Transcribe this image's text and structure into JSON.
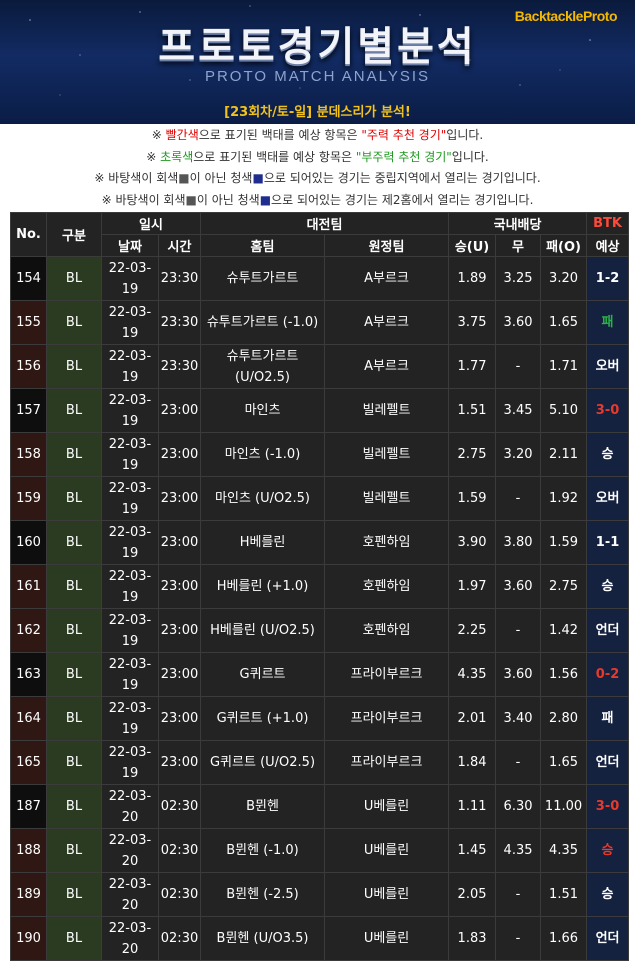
{
  "header": {
    "brand": "BacktackleProto",
    "title": "프로토경기별분석",
    "subtitle": "PROTO MATCH ANALYSIS",
    "round": "[23회차/토-일] 분데스리가 분석!"
  },
  "notes": {
    "n1_a": "※ ",
    "n1_b": "빨간색",
    "n1_c": "으로 표기된 백태를 예상 항목은 ",
    "n1_d": "\"주력 추천 경기\"",
    "n1_e": "입니다.",
    "n2_a": "※ ",
    "n2_b": "초록색",
    "n2_c": "으로 표기된 백태를 예상 항목은 ",
    "n2_d": "\"부주력 추천 경기\"",
    "n2_e": "입니다.",
    "n3_a": "※ 바탕색이 회색",
    "n3_b": "■",
    "n3_c": "이 아닌 청색",
    "n3_d": "■",
    "n3_e": "으로 되어있는 경기는 중립지역에서 열리는 경기입니다.",
    "n4_a": "※ 바탕색이 회색",
    "n4_b": "■",
    "n4_c": "이 아닌 청색",
    "n4_d": "■",
    "n4_e": "으로 되어있는 경기는 제2홈에서 열리는 경기입니다."
  },
  "table": {
    "h_no": "No.",
    "h_div": "구분",
    "h_datetime": "일시",
    "h_match": "대전팀",
    "h_odds": "국내배당",
    "h_btk_1": "BTK",
    "h_btk_2": "예상",
    "h_date": "날짜",
    "h_time": "시간",
    "h_home": "홈팀",
    "h_away": "원정팀",
    "h_win": "승(U)",
    "h_draw": "무",
    "h_lose": "패(O)"
  },
  "rows": [
    {
      "no": "154",
      "div": "BL",
      "date1": "22-03-",
      "date2": "19",
      "time": "23:30",
      "home": "슈투트가르트",
      "away": "A부르크",
      "w": "1.89",
      "d": "3.25",
      "l": "3.20",
      "pred": "1-2",
      "pc": "white",
      "nr": false
    },
    {
      "no": "155",
      "div": "BL",
      "date1": "22-03-",
      "date2": "19",
      "time": "23:30",
      "home": "슈투트가르트 (-1.0)",
      "away": "A부르크",
      "w": "3.75",
      "d": "3.60",
      "l": "1.65",
      "pred": "패",
      "pc": "green",
      "nr": true
    },
    {
      "no": "156",
      "div": "BL",
      "date1": "22-03-",
      "date2": "19",
      "time": "23:30",
      "home": "슈투트가르트",
      "home2": "(U/O2.5)",
      "away": "A부르크",
      "w": "1.77",
      "d": "-",
      "l": "1.71",
      "pred": "오버",
      "pc": "white",
      "nr": true
    },
    {
      "no": "157",
      "div": "BL",
      "date1": "22-03-",
      "date2": "19",
      "time": "23:00",
      "home": "마인츠",
      "away": "빌레펠트",
      "w": "1.51",
      "d": "3.45",
      "l": "5.10",
      "pred": "3-0",
      "pc": "red",
      "nr": false
    },
    {
      "no": "158",
      "div": "BL",
      "date1": "22-03-",
      "date2": "19",
      "time": "23:00",
      "home": "마인츠 (-1.0)",
      "away": "빌레펠트",
      "w": "2.75",
      "d": "3.20",
      "l": "2.11",
      "pred": "승",
      "pc": "white",
      "nr": true
    },
    {
      "no": "159",
      "div": "BL",
      "date1": "22-03-",
      "date2": "19",
      "time": "23:00",
      "home": "마인츠 (U/O2.5)",
      "away": "빌레펠트",
      "w": "1.59",
      "d": "-",
      "l": "1.92",
      "pred": "오버",
      "pc": "white",
      "nr": true
    },
    {
      "no": "160",
      "div": "BL",
      "date1": "22-03-",
      "date2": "19",
      "time": "23:00",
      "home": "H베를린",
      "away": "호펜하임",
      "w": "3.90",
      "d": "3.80",
      "l": "1.59",
      "pred": "1-1",
      "pc": "white",
      "nr": false
    },
    {
      "no": "161",
      "div": "BL",
      "date1": "22-03-",
      "date2": "19",
      "time": "23:00",
      "home": "H베를린 (+1.0)",
      "away": "호펜하임",
      "w": "1.97",
      "d": "3.60",
      "l": "2.75",
      "pred": "승",
      "pc": "white",
      "nr": true
    },
    {
      "no": "162",
      "div": "BL",
      "date1": "22-03-",
      "date2": "19",
      "time": "23:00",
      "home": "H베를린 (U/O2.5)",
      "away": "호펜하임",
      "w": "2.25",
      "d": "-",
      "l": "1.42",
      "pred": "언더",
      "pc": "white",
      "nr": true
    },
    {
      "no": "163",
      "div": "BL",
      "date1": "22-03-",
      "date2": "19",
      "time": "23:00",
      "home": "G퀴르트",
      "away": "프라이부르크",
      "w": "4.35",
      "d": "3.60",
      "l": "1.56",
      "pred": "0-2",
      "pc": "red",
      "nr": false
    },
    {
      "no": "164",
      "div": "BL",
      "date1": "22-03-",
      "date2": "19",
      "time": "23:00",
      "home": "G퀴르트 (+1.0)",
      "away": "프라이부르크",
      "w": "2.01",
      "d": "3.40",
      "l": "2.80",
      "pred": "패",
      "pc": "white",
      "nr": true
    },
    {
      "no": "165",
      "div": "BL",
      "date1": "22-03-",
      "date2": "19",
      "time": "23:00",
      "home": "G퀴르트 (U/O2.5)",
      "away": "프라이부르크",
      "w": "1.84",
      "d": "-",
      "l": "1.65",
      "pred": "언더",
      "pc": "white",
      "nr": true
    },
    {
      "no": "187",
      "div": "BL",
      "date1": "22-03-",
      "date2": "20",
      "time": "02:30",
      "home": "B뮌헨",
      "away": "U베를린",
      "w": "1.11",
      "d": "6.30",
      "l": "11.00",
      "pred": "3-0",
      "pc": "red",
      "nr": false
    },
    {
      "no": "188",
      "div": "BL",
      "date1": "22-03-",
      "date2": "20",
      "time": "02:30",
      "home": "B뮌헨 (-1.0)",
      "away": "U베를린",
      "w": "1.45",
      "d": "4.35",
      "l": "4.35",
      "pred": "승",
      "pc": "red",
      "nr": true
    },
    {
      "no": "189",
      "div": "BL",
      "date1": "22-03-",
      "date2": "20",
      "time": "02:30",
      "home": "B뮌헨 (-2.5)",
      "away": "U베를린",
      "w": "2.05",
      "d": "-",
      "l": "1.51",
      "pred": "승",
      "pc": "white",
      "nr": true
    },
    {
      "no": "190",
      "div": "BL",
      "date1": "22-03-",
      "date2": "20",
      "time": "02:30",
      "home": "B뮌헨 (U/O3.5)",
      "away": "U베를린",
      "w": "1.83",
      "d": "-",
      "l": "1.66",
      "pred": "언더",
      "pc": "white",
      "nr": true
    }
  ]
}
